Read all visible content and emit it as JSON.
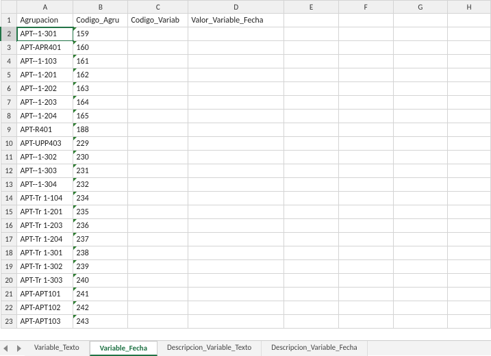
{
  "columns": [
    "A",
    "B",
    "C",
    "D",
    "E",
    "F",
    "G",
    "H"
  ],
  "headers": {
    "A": "Agrupacion",
    "B": "Codigo_Agru",
    "C": "Codigo_Variab",
    "D": "Valor_Variable_Fecha"
  },
  "rows": [
    {
      "n": 1
    },
    {
      "n": 2,
      "A": "APT--1-301",
      "B": "159"
    },
    {
      "n": 3,
      "A": "APT-APR401",
      "B": "160"
    },
    {
      "n": 4,
      "A": "APT--1-103",
      "B": "161"
    },
    {
      "n": 5,
      "A": "APT--1-201",
      "B": "162"
    },
    {
      "n": 6,
      "A": "APT--1-202",
      "B": "163"
    },
    {
      "n": 7,
      "A": "APT--1-203",
      "B": "164"
    },
    {
      "n": 8,
      "A": "APT--1-204",
      "B": "165"
    },
    {
      "n": 9,
      "A": "APT-R401",
      "B": "188"
    },
    {
      "n": 10,
      "A": "APT-UPP403",
      "B": "229"
    },
    {
      "n": 11,
      "A": "APT--1-302",
      "B": "230"
    },
    {
      "n": 12,
      "A": "APT--1-303",
      "B": "231"
    },
    {
      "n": 13,
      "A": "APT--1-304",
      "B": "232"
    },
    {
      "n": 14,
      "A": "APT-Tr 1-104",
      "B": "234"
    },
    {
      "n": 15,
      "A": "APT-Tr 1-201",
      "B": "235"
    },
    {
      "n": 16,
      "A": "APT-Tr 1-203",
      "B": "236"
    },
    {
      "n": 17,
      "A": "APT-Tr 1-204",
      "B": "237"
    },
    {
      "n": 18,
      "A": "APT-Tr 1-301",
      "B": "238"
    },
    {
      "n": 19,
      "A": "APT-Tr 1-302",
      "B": "239"
    },
    {
      "n": 20,
      "A": "APT-Tr 1-303",
      "B": "240"
    },
    {
      "n": 21,
      "A": "APT-APT101",
      "B": "241"
    },
    {
      "n": 22,
      "A": "APT-APT102",
      "B": "242"
    },
    {
      "n": 23,
      "A": "APT-APT103",
      "B": "243"
    }
  ],
  "active_cell": {
    "row": 2,
    "col": "A"
  },
  "tabs": [
    {
      "label": "Variable_Texto",
      "active": false
    },
    {
      "label": "Variable_Fecha",
      "active": true
    },
    {
      "label": "Descripcion_Variable_Texto",
      "active": false
    },
    {
      "label": "Descripcion_Variable_Fecha",
      "active": false
    }
  ]
}
